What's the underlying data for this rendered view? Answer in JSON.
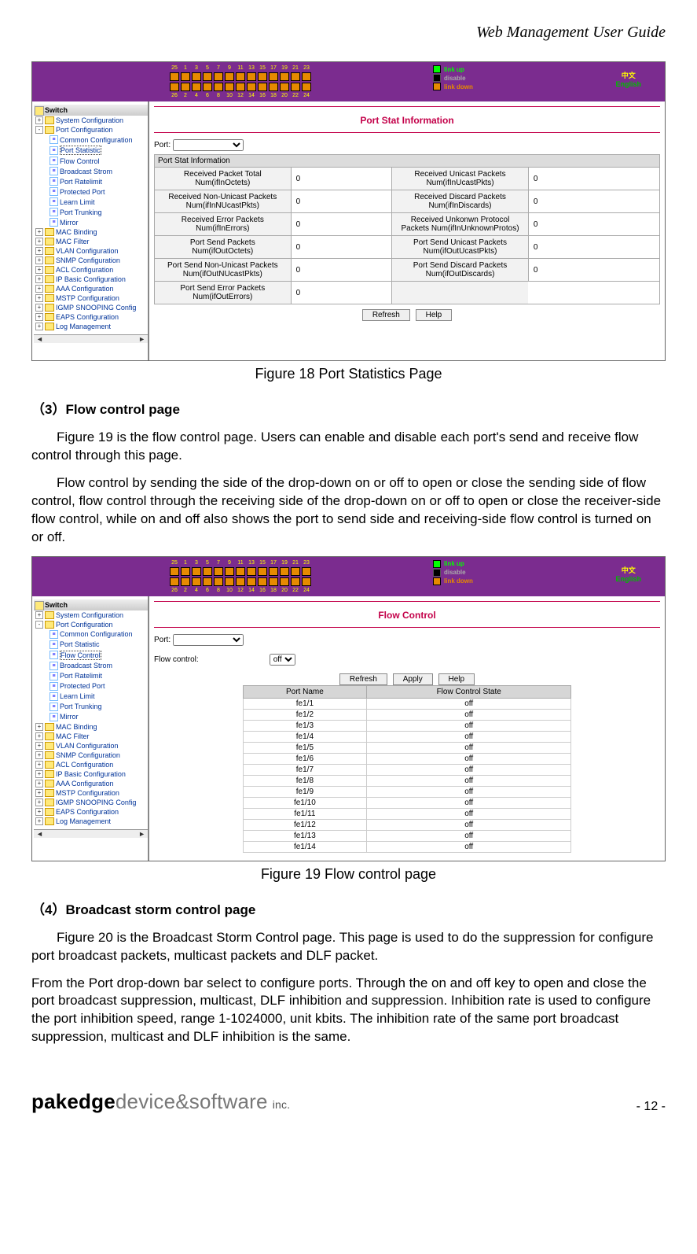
{
  "doc_header": "Web Management User Guide",
  "legend": {
    "up": "link up",
    "disable": "disable",
    "down": "link down"
  },
  "lang": {
    "cn": "中文",
    "en": "English"
  },
  "port_nums_top": [
    "25",
    "1",
    "3",
    "5",
    "7",
    "9",
    "11",
    "13",
    "15",
    "17",
    "19",
    "21",
    "23"
  ],
  "port_nums_bot": [
    "26",
    "2",
    "4",
    "6",
    "8",
    "10",
    "12",
    "14",
    "16",
    "18",
    "20",
    "22",
    "24"
  ],
  "sidebar": {
    "root": "Switch",
    "top": [
      "System Configuration",
      "Port Configuration"
    ],
    "port_children": [
      "Common Configuration",
      "Port Statistic",
      "Flow Control",
      "Broadcast Strom",
      "Port Ratelimit",
      "Protected Port",
      "Learn Limit",
      "Port Trunking",
      "Mirror"
    ],
    "bottom": [
      "MAC Binding",
      "MAC Filter",
      "VLAN Configuration",
      "SNMP Configuration",
      "ACL Configuration",
      "IP Basic Configuration",
      "AAA Configuration",
      "MSTP Configuration",
      "IGMP SNOOPING Config",
      "EAPS Configuration",
      "Log Management"
    ]
  },
  "fig18": {
    "title": "Port Stat Information",
    "port_label": "Port:",
    "table_caption": "Port Stat Information",
    "rows": [
      {
        "l": "Received Packet Total Num(ifInOctets)",
        "lv": "0",
        "r": "Received Unicast Packets Num(ifInUcastPkts)",
        "rv": "0"
      },
      {
        "l": "Received Non-Unicast Packets Num(ifInNUcastPkts)",
        "lv": "0",
        "r": "Received Discard Packets Num(ifInDiscards)",
        "rv": "0"
      },
      {
        "l": "Received Error Packets Num(ifInErrors)",
        "lv": "0",
        "r": "Received Unkonwn Protocol Packets Num(ifInUnknownProtos)",
        "rv": "0"
      },
      {
        "l": "Port Send Packets Num(ifOutOctets)",
        "lv": "0",
        "r": "Port Send Unicast Packets Num(ifOutUcastPkts)",
        "rv": "0"
      },
      {
        "l": "Port Send Non-Unicast Packets Num(ifOutNUcastPkts)",
        "lv": "0",
        "r": "Port Send Discard Packets Num(ifOutDiscards)",
        "rv": "0"
      },
      {
        "l": "Port Send Error Packets Num(ifOutErrors)",
        "lv": "0",
        "r": "",
        "rv": ""
      }
    ],
    "btn_refresh": "Refresh",
    "btn_help": "Help",
    "caption": "Figure 18 Port Statistics Page"
  },
  "section3": {
    "head": "（3）Flow control page",
    "p1": "Figure 19 is the flow control page. Users can enable and disable each port's send and receive flow control through this page.",
    "p2": "Flow control by sending the side of the drop-down on or off to open or close the sending side of flow control, flow control through the receiving side of the drop-down on or off to open or close the receiver-side flow control, while on and off also shows the port to send side and receiving-side flow control is turned on or off."
  },
  "fig19": {
    "title": "Flow Control",
    "port_label": "Port:",
    "fc_label": "Flow control:",
    "fc_value": "off",
    "btn_refresh": "Refresh",
    "btn_apply": "Apply",
    "btn_help": "Help",
    "th_port": "Port Name",
    "th_state": "Flow Control State",
    "rows": [
      {
        "p": "fe1/1",
        "s": "off"
      },
      {
        "p": "fe1/2",
        "s": "off"
      },
      {
        "p": "fe1/3",
        "s": "off"
      },
      {
        "p": "fe1/4",
        "s": "off"
      },
      {
        "p": "fe1/5",
        "s": "off"
      },
      {
        "p": "fe1/6",
        "s": "off"
      },
      {
        "p": "fe1/7",
        "s": "off"
      },
      {
        "p": "fe1/8",
        "s": "off"
      },
      {
        "p": "fe1/9",
        "s": "off"
      },
      {
        "p": "fe1/10",
        "s": "off"
      },
      {
        "p": "fe1/11",
        "s": "off"
      },
      {
        "p": "fe1/12",
        "s": "off"
      },
      {
        "p": "fe1/13",
        "s": "off"
      },
      {
        "p": "fe1/14",
        "s": "off"
      }
    ],
    "caption": "Figure 19 Flow control page"
  },
  "section4": {
    "head": "（4）Broadcast storm control page",
    "p1": "Figure 20 is the Broadcast Storm Control page. This page is used to do the suppression for configure port broadcast packets, multicast packets and DLF packet.",
    "p2": "From the Port drop-down bar select to configure ports. Through the on and off   key to open and close the port broadcast suppression, multicast, DLF inhibition and suppression. Inhibition rate is used to configure the port   inhibition speed, range 1-1024000, unit kbits. The inhibition rate of the same port broadcast suppression, multicast and DLF inhibition is the same."
  },
  "footer": {
    "brand_a": "pakedge",
    "brand_b": "device&software",
    "brand_c": " inc.",
    "page": "- 12 -"
  }
}
